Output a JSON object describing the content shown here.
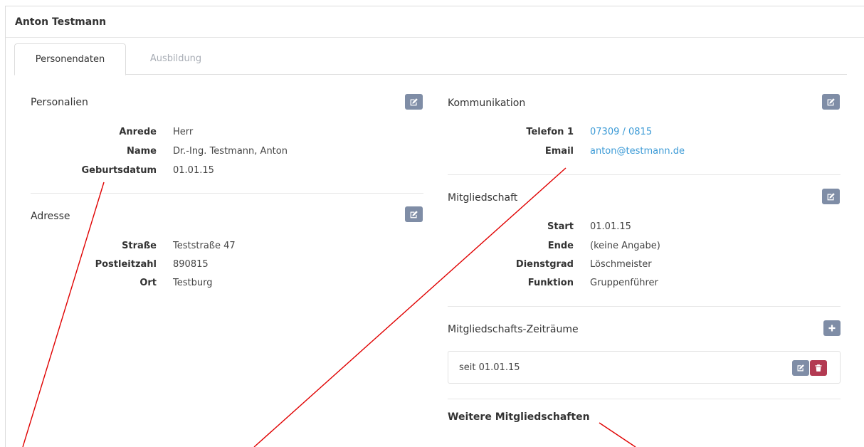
{
  "panel": {
    "title": "Anton Testmann"
  },
  "tabs": [
    {
      "label": "Personendaten",
      "active": true
    },
    {
      "label": "Ausbildung",
      "active": false
    }
  ],
  "personalien": {
    "title": "Personalien",
    "rows": [
      {
        "label": "Anrede",
        "value": "Herr"
      },
      {
        "label": "Name",
        "value": "Dr.-Ing. Testmann, Anton"
      },
      {
        "label": "Geburtsdatum",
        "value": "01.01.15"
      }
    ]
  },
  "adresse": {
    "title": "Adresse",
    "rows": [
      {
        "label": "Straße",
        "value": "Teststraße 47"
      },
      {
        "label": "Postleitzahl",
        "value": "890815"
      },
      {
        "label": "Ort",
        "value": "Testburg"
      }
    ]
  },
  "kommunikation": {
    "title": "Kommunikation",
    "rows": [
      {
        "label": "Telefon 1",
        "value": "07309 / 0815"
      },
      {
        "label": "Email",
        "value": "anton@testmann.de"
      }
    ]
  },
  "mitgliedschaft": {
    "title": "Mitgliedschaft",
    "rows": [
      {
        "label": "Start",
        "value": "01.01.15"
      },
      {
        "label": "Ende",
        "value": "(keine Angabe)"
      },
      {
        "label": "Dienstgrad",
        "value": "Löschmeister"
      },
      {
        "label": "Funktion",
        "value": "Gruppenführer"
      }
    ]
  },
  "zeitraeume": {
    "title": "Mitgliedschafts-Zeiträume",
    "items": [
      {
        "text": "seit 01.01.15"
      }
    ]
  },
  "weitere": {
    "title": "Weitere Mitgliedschaften"
  },
  "icons": {
    "edit": "edit-icon",
    "delete": "trash-icon",
    "add": "plus-icon"
  },
  "colors": {
    "button_gray": "#7f8da6",
    "button_danger": "#b33a52",
    "link": "#3b9ad6",
    "annotation": "#e00000"
  }
}
